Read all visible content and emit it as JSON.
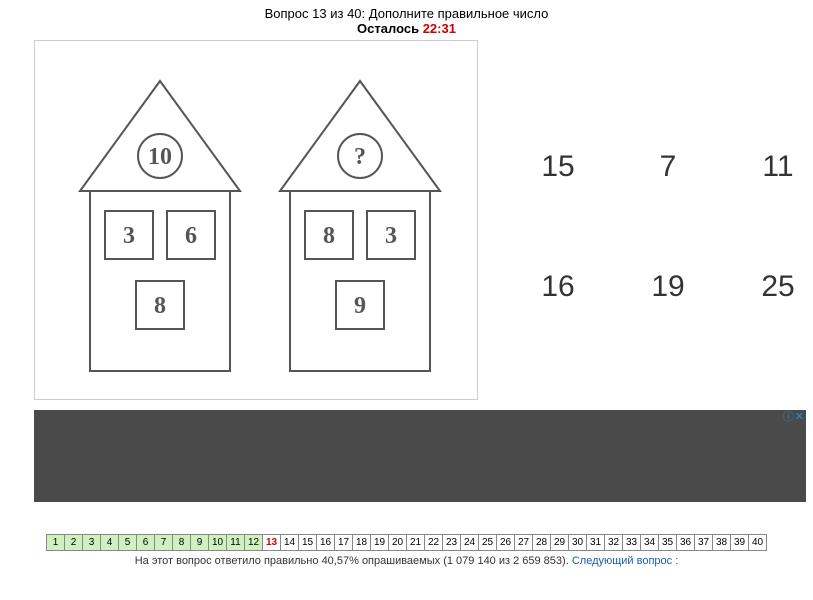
{
  "header": {
    "question_prefix": "Вопрос",
    "question_num": "13",
    "of_word": "из",
    "total": "40",
    "prompt": "Дополните правильное число",
    "timer_label": "Осталось",
    "timer_value": "22:31"
  },
  "chart_data": {
    "type": "table",
    "houses": [
      {
        "roof": "10",
        "windows": [
          "3",
          "6",
          "8"
        ]
      },
      {
        "roof": "?",
        "windows": [
          "8",
          "3",
          "9"
        ]
      }
    ]
  },
  "answers": {
    "options": [
      "15",
      "7",
      "11",
      "16",
      "19",
      "25"
    ]
  },
  "nav": {
    "total": 40,
    "answered_through": 12,
    "current": 13
  },
  "footer": {
    "stats_prefix": "На этот вопрос ответило правильно",
    "percent": "40,57%",
    "stats_mid": "опрашиваемых",
    "stats_detail": "(1 079 140 из 2 659 853).",
    "next_label": "Следующий вопрос :"
  }
}
